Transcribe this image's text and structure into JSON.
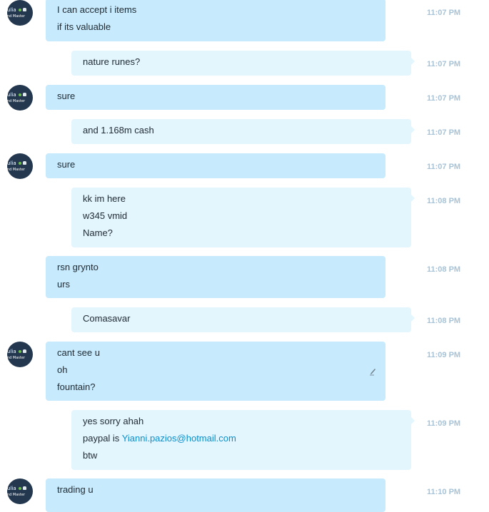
{
  "avatar": {
    "line1": "ulia",
    "line2": "nd Master"
  },
  "messages": [
    {
      "lines": [
        "I can accept i items",
        "if its valuable"
      ],
      "time": "11:07 PM"
    },
    {
      "lines": [
        "nature runes?"
      ],
      "time": "11:07 PM"
    },
    {
      "lines": [
        "sure"
      ],
      "time": "11:07 PM"
    },
    {
      "lines": [
        "and 1.168m cash"
      ],
      "time": "11:07 PM"
    },
    {
      "lines": [
        "sure"
      ],
      "time": "11:07 PM"
    },
    {
      "lines": [
        "kk im here",
        "w345 vmid",
        "Name?"
      ],
      "time": "11:08 PM"
    },
    {
      "lines": [
        "rsn grynto",
        "urs"
      ],
      "time": "11:08 PM"
    },
    {
      "lines": [
        "Comasavar"
      ],
      "time": "11:08 PM"
    },
    {
      "lines": [
        "cant see u",
        "oh",
        "fountain?"
      ],
      "time": "11:09 PM"
    },
    {
      "lines": [
        "yes sorry ahah",
        "paypal is ",
        "btw"
      ],
      "link": "Yianni.pazios@hotmail.com",
      "time": "11:09 PM"
    },
    {
      "lines": [
        "trading u"
      ],
      "time": "11:10 PM"
    }
  ],
  "icons": {
    "avatar": "avatar-icon",
    "edit": "pencil-icon"
  },
  "colors": {
    "incoming_bubble": "#c7eafc",
    "outgoing_bubble": "#e3f5fd",
    "timestamp": "#a8c3d6",
    "link": "#0a8fcc",
    "avatar_bg": "#23384f"
  }
}
